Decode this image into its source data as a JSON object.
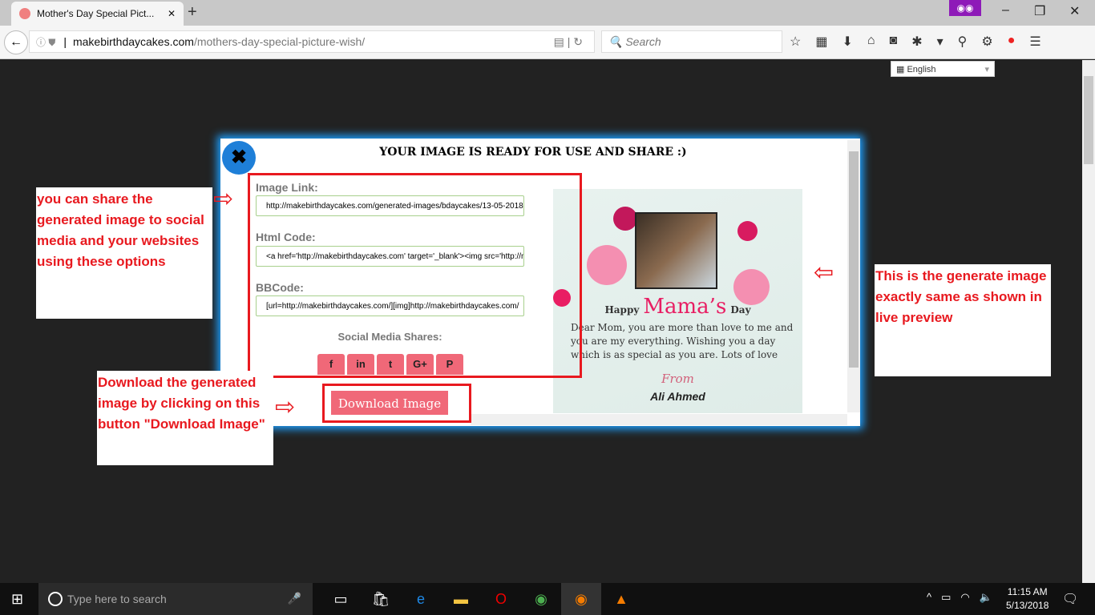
{
  "browser": {
    "tab_title": "Mother's Day Special Pict...",
    "tab_close": "✕",
    "new_tab": "+",
    "url_host": "makebirthdaycakes.com",
    "url_path": "/mothers-day-special-picture-wish/",
    "search_placeholder": "Search",
    "minimize": "–",
    "restore": "❐",
    "close": "✕",
    "toolbar_icons": [
      "star-icon",
      "reading-list-icon",
      "download-icon",
      "home-icon",
      "pocket-icon",
      "extension-icon",
      "menu-dropdown-icon",
      "pin-icon",
      "gear-icon",
      "colors-icon",
      "hamburger-menu-icon"
    ]
  },
  "language_select": {
    "value": "English"
  },
  "modal": {
    "title": "YOUR IMAGE IS READY FOR USE AND SHARE :)",
    "image_link_label": "Image Link:",
    "image_link_value": "http://makebirthdaycakes.com/generated-images/bdaycakes/13-05-2018",
    "html_code_label": "Html Code:",
    "html_code_value": "<a href='http://makebirthdaycakes.com' target='_blank'><img src='http://m",
    "bbcode_label": "BBCode:",
    "bbcode_value": "[url=http://makebirthdaycakes.com/][img]http://makebirthdaycakes.com/",
    "social_label": "Social Media Shares:",
    "social": [
      {
        "name": "facebook",
        "glyph": "f"
      },
      {
        "name": "linkedin",
        "glyph": "in"
      },
      {
        "name": "twitter",
        "glyph": "t"
      },
      {
        "name": "google-plus",
        "glyph": "G+"
      },
      {
        "name": "pinterest",
        "glyph": "P"
      }
    ],
    "download_label": "Download Image"
  },
  "card": {
    "happy": "Happy",
    "mama": "Mama’s",
    "day": "Day",
    "message": "Dear Mom, you are more than love to me and you are my everything. Wishing you a day which is as special as you are. Lots of love",
    "from": "From",
    "name": "Ali Ahmed"
  },
  "annotations": {
    "share": "you can share the generated image to social media and your websites using these options",
    "preview": "This is the generate image exactly same as shown in live preview",
    "download": "Download the generated image by clicking on this button \"Download Image\""
  },
  "taskbar": {
    "search_placeholder": "Type here to search",
    "time": "11:15 AM",
    "date": "5/13/2018"
  },
  "colors": {
    "accent_pink": "#f06878",
    "annotation_red": "#e8191f",
    "modal_glow": "#1ea0ff",
    "close_button": "#1e7fd8"
  }
}
